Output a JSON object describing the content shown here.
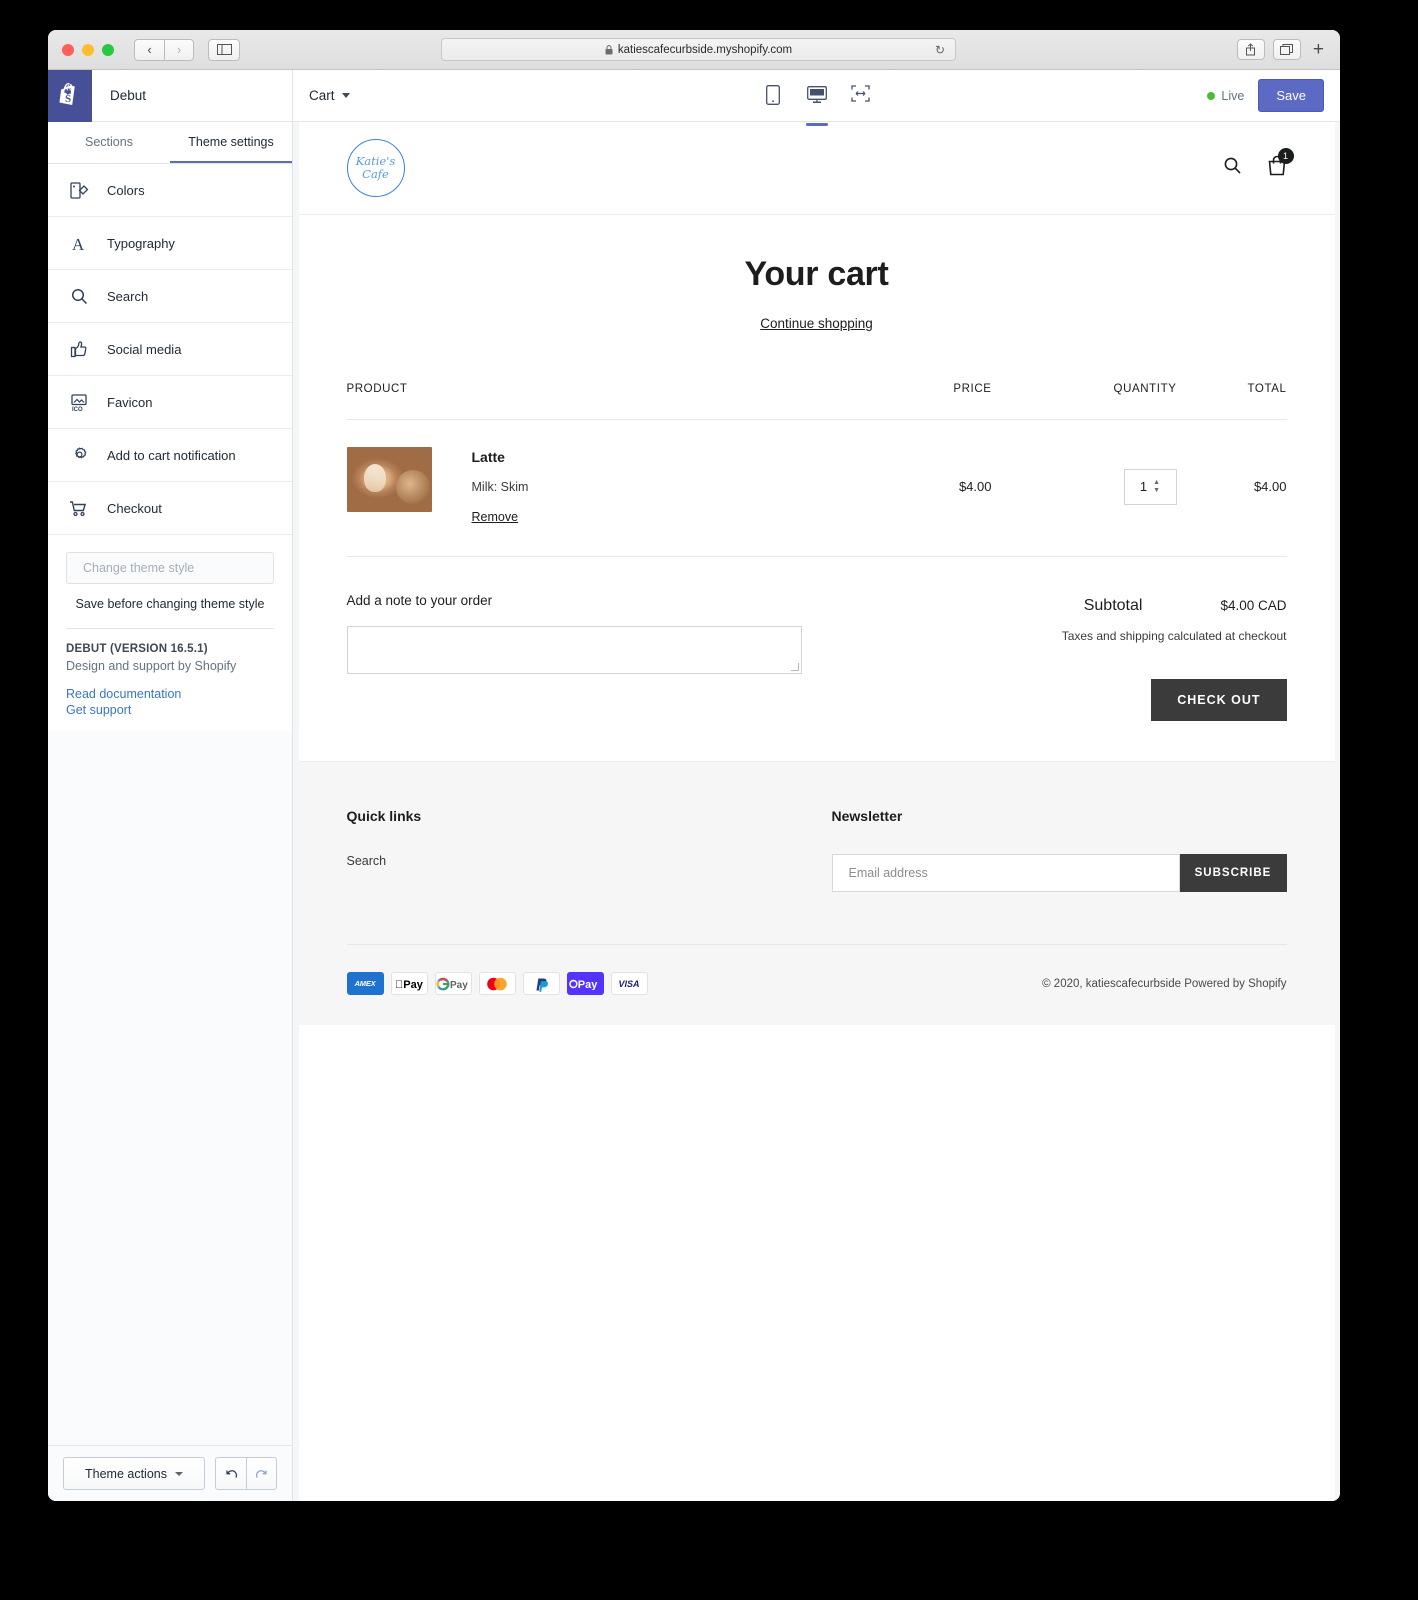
{
  "browser": {
    "url": "katiescafecurbside.myshopify.com",
    "lock_icon": "lock-icon",
    "back_icon": "‹",
    "forward_icon": "›",
    "reload_icon": "↻",
    "share_icon": "share-icon",
    "tabs_icon": "tabs-icon",
    "new_tab_icon": "+"
  },
  "editor": {
    "theme_name": "Debut",
    "tabs": [
      {
        "label": "Sections",
        "active": false
      },
      {
        "label": "Theme settings",
        "active": true
      }
    ],
    "settings": [
      {
        "label": "Colors",
        "icon": "colors-icon"
      },
      {
        "label": "Typography",
        "icon": "typography-icon"
      },
      {
        "label": "Search",
        "icon": "search-icon"
      },
      {
        "label": "Social media",
        "icon": "thumbs-up-icon"
      },
      {
        "label": "Favicon",
        "icon": "favicon-icon"
      },
      {
        "label": "Add to cart notification",
        "icon": "gear-icon"
      },
      {
        "label": "Checkout",
        "icon": "cart-icon"
      }
    ],
    "change_theme_style": "Change theme style",
    "save_before_note": "Save before changing theme style",
    "version": "DEBUT (VERSION 16.5.1)",
    "design_by": "Design and support by Shopify",
    "read_documentation": "Read documentation",
    "get_support": "Get support",
    "theme_actions": "Theme actions",
    "undo_icon": "undo-icon",
    "redo_icon": "redo-icon"
  },
  "topbar": {
    "page": "Cart",
    "devices": [
      {
        "name": "mobile",
        "active": false
      },
      {
        "name": "desktop",
        "active": true
      },
      {
        "name": "full-width",
        "active": false
      }
    ],
    "live_label": "Live",
    "save_label": "Save"
  },
  "store": {
    "logo_line1": "Katie's",
    "logo_line2": "Cafe",
    "search_icon": "search-icon",
    "cart_icon": "shopping-bag-icon",
    "cart_count": "1",
    "title": "Your cart",
    "continue_shopping": "Continue shopping",
    "table_headers": {
      "product": "PRODUCT",
      "price": "PRICE",
      "quantity": "QUANTITY",
      "total": "TOTAL"
    },
    "items": [
      {
        "title": "Latte",
        "variant": "Milk: Skim",
        "remove": "Remove",
        "price": "$4.00",
        "quantity": "1",
        "total": "$4.00",
        "image": "latte-art-photo"
      }
    ],
    "note_label": "Add a note to your order",
    "note_value": "",
    "subtotal_label": "Subtotal",
    "subtotal_value": "$4.00 CAD",
    "taxes_note": "Taxes and shipping calculated at checkout",
    "checkout_button": "CHECK OUT",
    "footer": {
      "quick_links_title": "Quick links",
      "quick_links": [
        "Search"
      ],
      "newsletter_title": "Newsletter",
      "email_placeholder": "Email address",
      "subscribe_button": "SUBSCRIBE",
      "payment_methods": [
        {
          "name": "AMEX",
          "label": "AMEX"
        },
        {
          "name": "Apple Pay",
          "label": "Pay"
        },
        {
          "name": "Google Pay",
          "label": "Pay"
        },
        {
          "name": "Mastercard",
          "label": ""
        },
        {
          "name": "PayPal",
          "label": ""
        },
        {
          "name": "Shop Pay",
          "label": "Pay"
        },
        {
          "name": "Visa",
          "label": "VISA"
        }
      ],
      "copyright": "© 2020, katiescafecurbside Powered by Shopify"
    }
  },
  "colors": {
    "accent": "#5c6ac4",
    "live_green": "#50b83c",
    "logo_blue": "#3b83d6",
    "dark_button": "#3b3b3b",
    "link_blue": "#3a76c4"
  }
}
